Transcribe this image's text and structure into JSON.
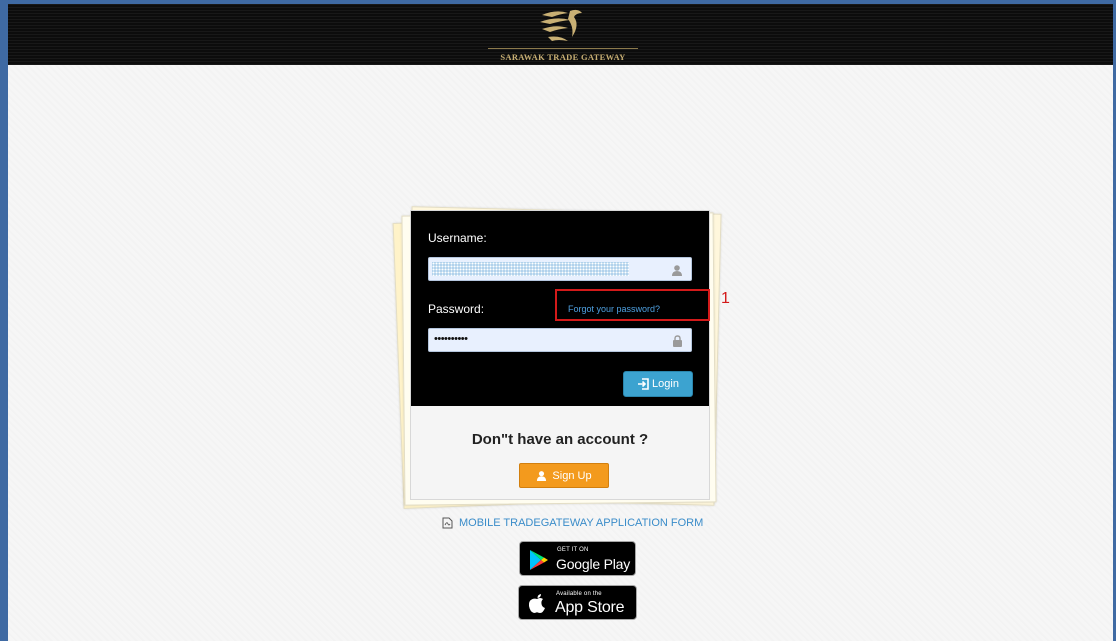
{
  "header": {
    "logo_text": "SARAWAK TRADE GATEWAY"
  },
  "login": {
    "username_label": "Username:",
    "password_label": "Password:",
    "forgot_link": "Forgot your password?",
    "password_value": "••••••••••",
    "login_button": "Login"
  },
  "signup": {
    "prompt": "Don\"t have an account ?",
    "button": "Sign Up"
  },
  "annotation": {
    "number": "1",
    "color": "#d31a1a"
  },
  "mobile_form_link": "MOBILE TRADEGATEWAY APPLICATION FORM",
  "stores": {
    "google_small": "GET IT ON",
    "google_big": "Google Play",
    "apple_small": "Available on the",
    "apple_big": "App Store"
  },
  "colors": {
    "login_button": "#3ca3d0",
    "signup_button": "#f39a1d",
    "link": "#3a8cc9"
  }
}
